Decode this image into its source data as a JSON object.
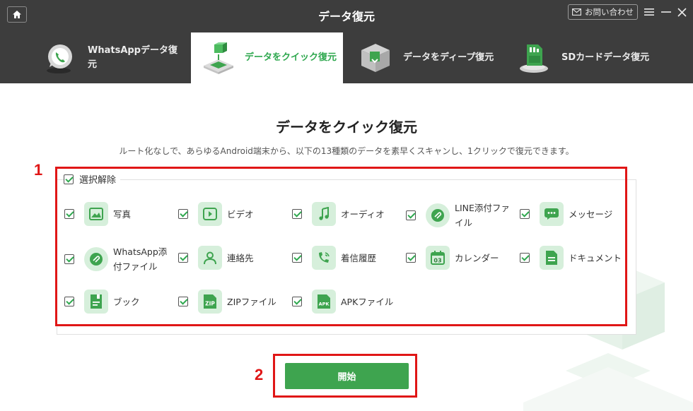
{
  "app": {
    "title": "データ復元"
  },
  "header": {
    "contact_label": "お問い合わせ"
  },
  "tabs": [
    {
      "label": "WhatsAppデータ復元",
      "icon": "whatsapp-icon"
    },
    {
      "label": "データをクイック復元",
      "icon": "quick-restore-icon"
    },
    {
      "label": "データをディープ復元",
      "icon": "deep-restore-icon"
    },
    {
      "label": "SDカードデータ復元",
      "icon": "sd-card-icon"
    }
  ],
  "main": {
    "title": "データをクイック復元",
    "description": "ルート化なしで、あらゆるAndroid端末から、以下の13種類のデータを素早くスキャンし、1クリックで復元できます。",
    "select_all_label": "選択解除",
    "items": [
      {
        "label": "写真",
        "icon": "photo-icon"
      },
      {
        "label": "ビデオ",
        "icon": "video-icon"
      },
      {
        "label": "オーディオ",
        "icon": "music-icon"
      },
      {
        "label": "LINE添付ファイル",
        "icon": "line-attachment-icon"
      },
      {
        "label": "メッセージ",
        "icon": "message-icon"
      },
      {
        "label": "WhatsApp添付ファイル",
        "icon": "whatsapp-attachment-icon"
      },
      {
        "label": "連絡先",
        "icon": "contact-icon"
      },
      {
        "label": "着信履歴",
        "icon": "call-log-icon"
      },
      {
        "label": "カレンダー",
        "icon": "calendar-icon"
      },
      {
        "label": "ドキュメント",
        "icon": "document-icon"
      },
      {
        "label": "ブック",
        "icon": "book-icon"
      },
      {
        "label": "ZIPファイル",
        "icon": "zip-icon"
      },
      {
        "label": "APKファイル",
        "icon": "apk-icon"
      }
    ],
    "start_label": "開始"
  },
  "annotations": {
    "box1_number": "1",
    "box2_number": "2"
  },
  "colors": {
    "header_bg": "#3d3d3d",
    "accent_green": "#3ea44f",
    "icon_bg": "#d6efdb",
    "annotation_red": "#e01616"
  }
}
